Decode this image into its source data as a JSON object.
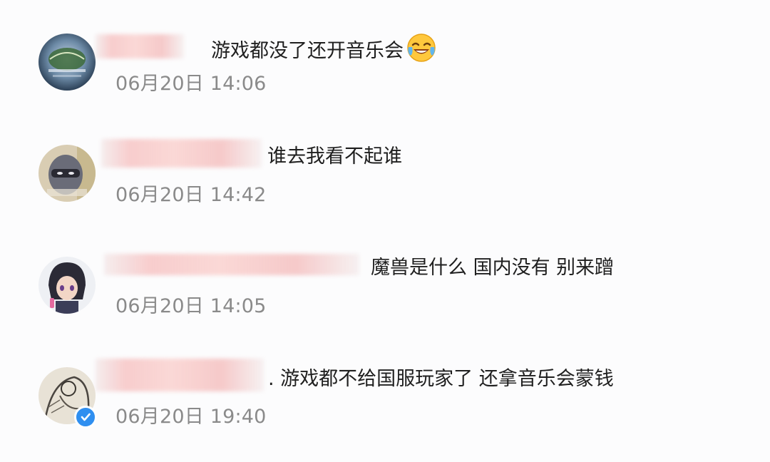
{
  "comments": [
    {
      "text": "游戏都没了还开音乐会",
      "emoji": "laughing-crying-emoji",
      "timestamp": "06月20日 14:06",
      "verified": false
    },
    {
      "text": "谁去我看不起谁",
      "timestamp": "06月20日 14:42",
      "verified": false
    },
    {
      "text": "魔兽是什么 国内没有 别来蹭",
      "timestamp": "06月20日 14:05",
      "verified": false
    },
    {
      "text": ". 游戏都不给国服玩家了 还拿音乐会蒙钱",
      "timestamp": "06月20日 19:40",
      "verified": true
    }
  ],
  "colors": {
    "background": "#fcfcfd",
    "text": "#1f1f1f",
    "timestamp": "#8a8a8a",
    "verified_badge": "#2f8ff0",
    "name_redaction": "#f6c4c4"
  }
}
